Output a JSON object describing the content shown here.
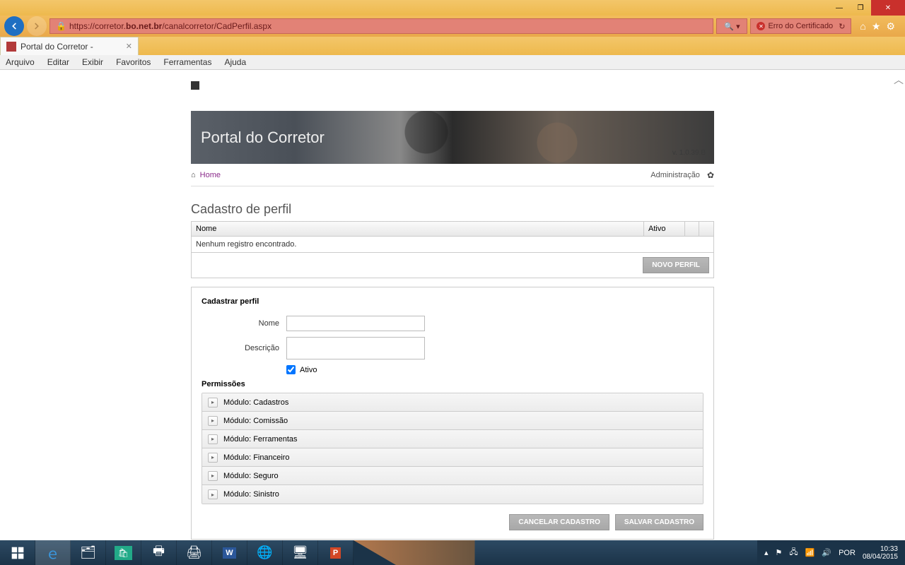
{
  "browser": {
    "url_prefix": "https://corretor.",
    "url_bold": "bo.net.br",
    "url_suffix": "/canalcorretor/CadPerfil.aspx",
    "cert_error": "Erro do Certificado",
    "tab_title": "Portal do Corretor -",
    "menu": [
      "Arquivo",
      "Editar",
      "Exibir",
      "Favoritos",
      "Ferramentas",
      "Ajuda"
    ]
  },
  "banner": {
    "title": "Portal do Corretor",
    "version": "v. 1.0.39.B"
  },
  "breadcrumb": {
    "home": "Home",
    "admin": "Administração"
  },
  "grid": {
    "title": "Cadastro de perfil",
    "col_nome": "Nome",
    "col_ativo": "Ativo",
    "empty": "Nenhum registro encontrado.",
    "new_btn": "NOVO PERFIL"
  },
  "form": {
    "title": "Cadastrar perfil",
    "label_nome": "Nome",
    "label_descricao": "Descrição",
    "label_ativo": "Ativo",
    "perm_title": "Permissões",
    "modules": [
      "Módulo: Cadastros",
      "Módulo: Comissão",
      "Módulo: Ferramentas",
      "Módulo: Financeiro",
      "Módulo: Seguro",
      "Módulo: Sinistro"
    ],
    "cancel_btn": "CANCELAR CADASTRO",
    "save_btn": "SALVAR CADASTRO"
  },
  "taskbar": {
    "lang": "POR",
    "time": "10:33",
    "date": "08/04/2015"
  }
}
